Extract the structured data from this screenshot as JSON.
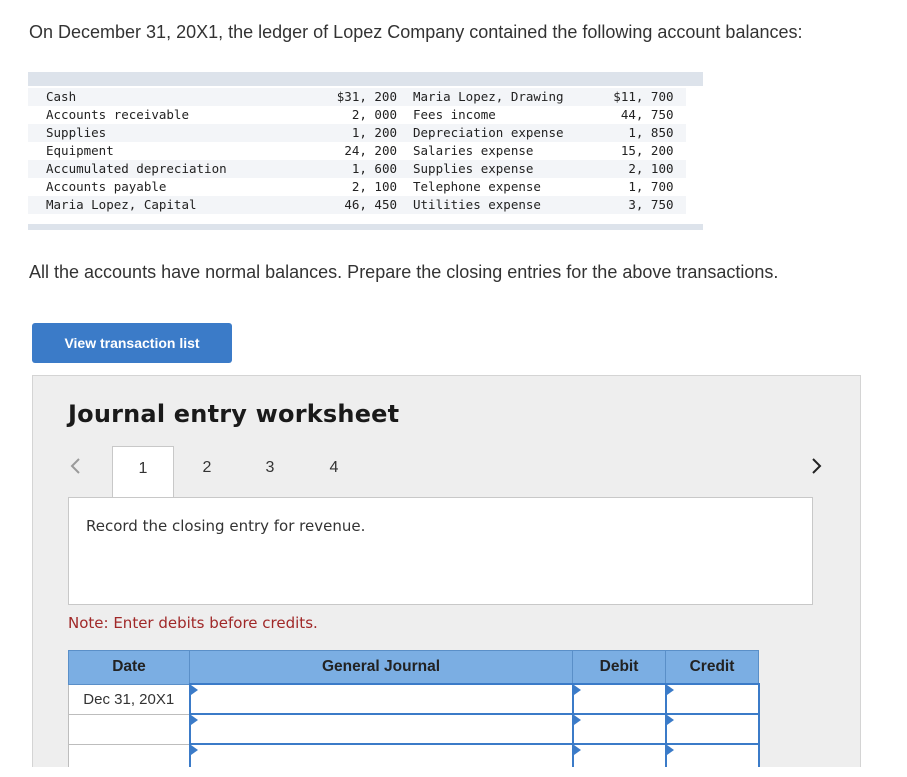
{
  "intro_text": "On December 31, 20X1, the ledger of Lopez Company contained the following account balances:",
  "ledger_rows": [
    {
      "account1": "Cash",
      "amount1": "$31, 200",
      "account2": "Maria Lopez, Drawing",
      "amount2": "$11, 700"
    },
    {
      "account1": "Accounts receivable",
      "amount1": "2, 000",
      "account2": "Fees income",
      "amount2": "44, 750"
    },
    {
      "account1": "Supplies",
      "amount1": "1, 200",
      "account2": "Depreciation expense",
      "amount2": "1, 850"
    },
    {
      "account1": "Equipment",
      "amount1": "24, 200",
      "account2": "Salaries expense",
      "amount2": "15, 200"
    },
    {
      "account1": "Accumulated depreciation",
      "amount1": "1, 600",
      "account2": "Supplies expense",
      "amount2": "2, 100"
    },
    {
      "account1": "Accounts payable",
      "amount1": "2, 100",
      "account2": "Telephone expense",
      "amount2": "1, 700"
    },
    {
      "account1": "Maria Lopez, Capital",
      "amount1": "46, 450",
      "account2": "Utilities expense",
      "amount2": "3, 750"
    }
  ],
  "instruction": "All the accounts have normal balances. Prepare the closing entries for the above transactions.",
  "view_button_label": "View transaction list",
  "worksheet": {
    "title": "Journal entry worksheet",
    "tabs": [
      "1",
      "2",
      "3",
      "4"
    ],
    "active_tab": "1",
    "entry_prompt": "Record the closing entry for revenue.",
    "note": "Note: Enter debits before credits.",
    "columns": {
      "date": "Date",
      "journal": "General Journal",
      "debit": "Debit",
      "credit": "Credit"
    },
    "rows": [
      {
        "date": "Dec 31, 20X1"
      },
      {
        "date": ""
      },
      {
        "date": ""
      }
    ]
  },
  "colors": {
    "button_blue": "#3b7bc8",
    "header_blue": "#7baee3",
    "note_red": "#a02828"
  }
}
